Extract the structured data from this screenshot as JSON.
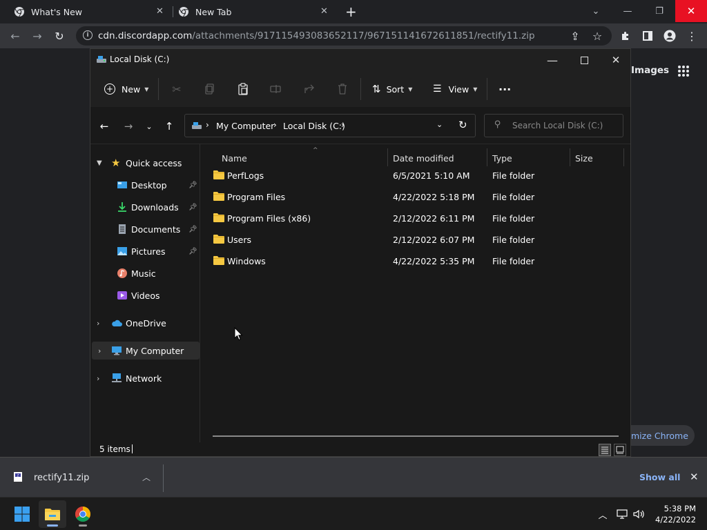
{
  "browser": {
    "tabs": [
      {
        "title": "What's New"
      },
      {
        "title": "New Tab"
      }
    ],
    "url_host": "cdn.discordapp.com",
    "url_path": "/attachments/917115493083652117/967151141672611851/rectify11.zip"
  },
  "background_page": {
    "images_link": "Images",
    "customize_button": "mize Chrome"
  },
  "explorer": {
    "title": "Local Disk (C:)",
    "commands": {
      "new_label": "New",
      "sort_label": "Sort",
      "view_label": "View",
      "more_label": "..."
    },
    "breadcrumb": [
      "My Computer",
      "Local Disk (C:)"
    ],
    "search_placeholder": "Search Local Disk (C:)",
    "sidebar": {
      "quick_access": "Quick access",
      "quick_items": [
        {
          "label": "Desktop",
          "icon": "desktop-icon"
        },
        {
          "label": "Downloads",
          "icon": "downloads-icon"
        },
        {
          "label": "Documents",
          "icon": "documents-icon"
        },
        {
          "label": "Pictures",
          "icon": "pictures-icon"
        },
        {
          "label": "Music",
          "icon": "music-icon"
        },
        {
          "label": "Videos",
          "icon": "videos-icon"
        }
      ],
      "onedrive": "OneDrive",
      "my_computer": "My Computer",
      "network": "Network"
    },
    "columns": {
      "name": "Name",
      "date": "Date modified",
      "type": "Type",
      "size": "Size"
    },
    "files": [
      {
        "name": "PerfLogs",
        "date": "6/5/2021 5:10 AM",
        "type": "File folder"
      },
      {
        "name": "Program Files",
        "date": "4/22/2022 5:18 PM",
        "type": "File folder"
      },
      {
        "name": "Program Files (x86)",
        "date": "2/12/2022 6:11 PM",
        "type": "File folder"
      },
      {
        "name": "Users",
        "date": "2/12/2022 6:07 PM",
        "type": "File folder"
      },
      {
        "name": "Windows",
        "date": "4/22/2022 5:35 PM",
        "type": "File folder"
      }
    ],
    "status": "5 items"
  },
  "downloads": {
    "file_name": "rectify11.zip",
    "show_all": "Show all"
  },
  "taskbar": {
    "time": "5:38 PM",
    "date": "4/22/2022"
  },
  "colors": {
    "folder": "#f5c842",
    "link": "#8ab4f8",
    "close_hover": "#e81123"
  }
}
